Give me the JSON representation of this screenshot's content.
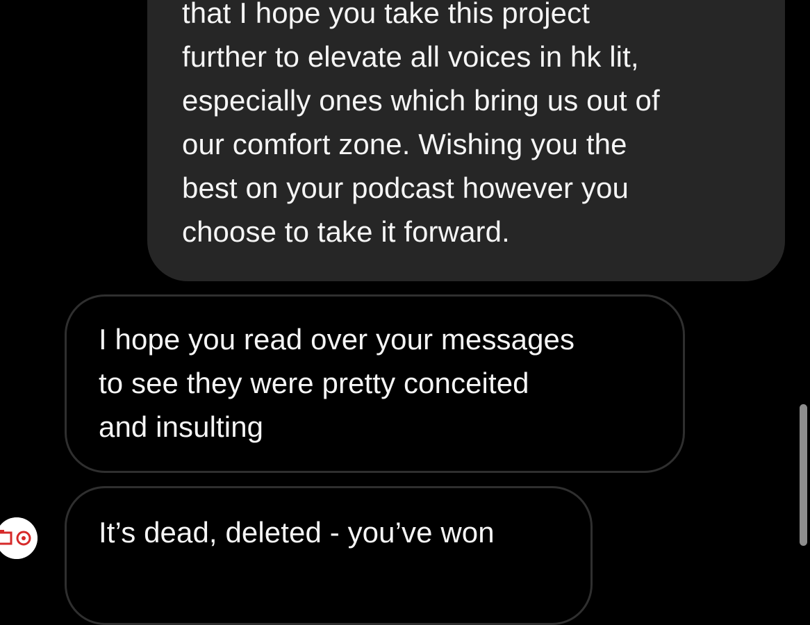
{
  "thread": {
    "messages": [
      {
        "sender": "me",
        "lines": [
          "that I hope you take this project",
          "further to elevate all voices in hk lit,",
          "especially ones which bring us out of",
          "our comfort zone. Wishing you the",
          "best on your podcast however you",
          "choose to take it forward."
        ]
      },
      {
        "sender": "other",
        "lines": [
          "I hope you read over your messages",
          "to see they were pretty conceited",
          "and insulting"
        ]
      },
      {
        "sender": "other",
        "lines": [
          "It’s dead, deleted - you’ve won"
        ]
      }
    ],
    "avatar_icon": "profile-avatar-icon"
  },
  "colors": {
    "background": "#000000",
    "sent_bubble": "#262626",
    "received_border": "#2f2f2f",
    "text": "#f5f5f5",
    "scrollbar": "#8e8e8e"
  }
}
